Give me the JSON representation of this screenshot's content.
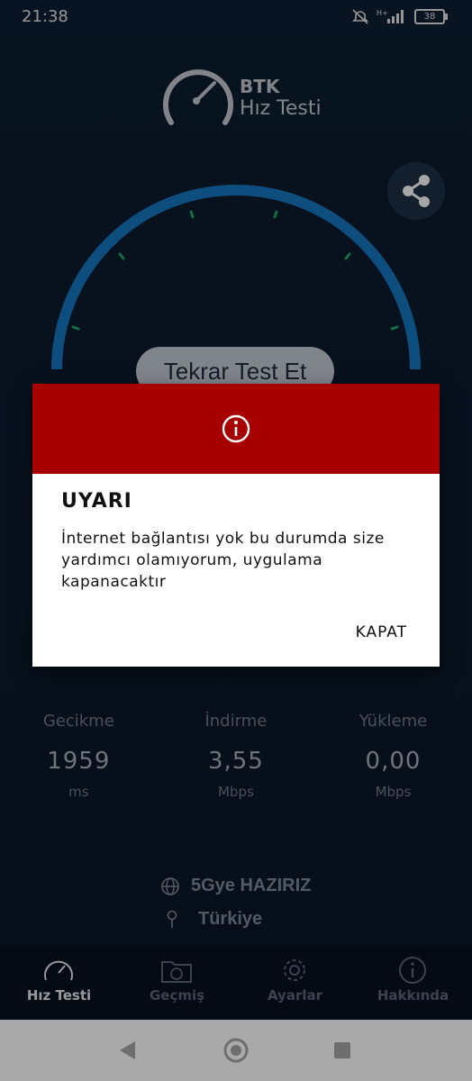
{
  "status": {
    "time": "21:38",
    "battery": "38"
  },
  "logo": {
    "title": "BTK",
    "subtitle": "Hız Testi"
  },
  "gauge": {
    "retest_label": "Tekrar Test Et"
  },
  "stats": [
    {
      "label": "Gecikme",
      "value": "1959",
      "unit": "ms"
    },
    {
      "label": "İndirme",
      "value": "3,55",
      "unit": "Mbps"
    },
    {
      "label": "Yükleme",
      "value": "0,00",
      "unit": "Mbps"
    }
  ],
  "network": {
    "operator": "5Gye HAZIRIZ",
    "location": "Türkiye"
  },
  "nav": [
    {
      "label": "Hız Testi",
      "icon": "speedometer-icon",
      "active": true
    },
    {
      "label": "Geçmiş",
      "icon": "history-folder-icon",
      "active": false
    },
    {
      "label": "Ayarlar",
      "icon": "gear-icon",
      "active": false
    },
    {
      "label": "Hakkında",
      "icon": "info-icon",
      "active": false
    }
  ],
  "dialog": {
    "title": "UYARI",
    "message": "İnternet bağlantısı yok bu durumda size yardımcı olamıyorum, uygulama kapanacaktır",
    "button": "KAPAT",
    "header_color": "#a70000"
  },
  "colors": {
    "accent": "#1678c2",
    "tick": "#1fa86a",
    "background": "#0c1a2b"
  }
}
